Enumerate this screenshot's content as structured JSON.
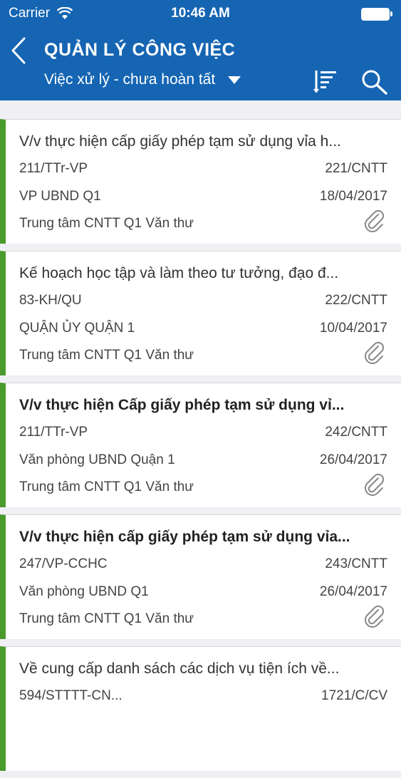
{
  "status_bar": {
    "carrier": "Carrier",
    "time": "10:46 AM"
  },
  "header": {
    "title": "QUẢN LÝ CÔNG VIỆC",
    "filter_label": "Việc xử lý - chưa hoàn tất"
  },
  "items": [
    {
      "subject": "V/v thực hiện cấp giấy phép tạm sử dụng vỉa h...",
      "doc_number": "211/TTr-VP",
      "code": "221/CNTT",
      "sender": "VP UBND Q1",
      "date": "18/04/2017",
      "recipient": "Trung tâm CNTT Q1 Văn thư",
      "unread": false
    },
    {
      "subject": "Kế hoạch học tập và làm theo tư tưởng, đạo đ...",
      "doc_number": "83-KH/QU",
      "code": "222/CNTT",
      "sender": "QUẬN ỦY QUẬN 1",
      "date": "10/04/2017",
      "recipient": "Trung tâm CNTT Q1 Văn thư",
      "unread": false
    },
    {
      "subject": "V/v thực hiện Cấp giấy phép tạm sử dụng vỉ...",
      "doc_number": "211/TTr-VP",
      "code": "242/CNTT",
      "sender": "Văn phòng UBND Quận 1",
      "date": "26/04/2017",
      "recipient": "Trung tâm CNTT Q1 Văn thư",
      "unread": true
    },
    {
      "subject": "V/v thực hiện cấp giấy phép tạm sử dụng vỉa...",
      "doc_number": "247/VP-CCHC",
      "code": "243/CNTT",
      "sender": "Văn phòng UBND Q1",
      "date": "26/04/2017",
      "recipient": "Trung tâm CNTT Q1 Văn thư",
      "unread": true
    },
    {
      "subject": "Về cung cấp danh sách các dịch vụ tiện ích về...",
      "doc_number": "594/STTTT-CN...",
      "code": "1721/C/CV"
    }
  ],
  "colors": {
    "header_bg": "#1565b3",
    "accent_bar": "#4a9a2c"
  }
}
